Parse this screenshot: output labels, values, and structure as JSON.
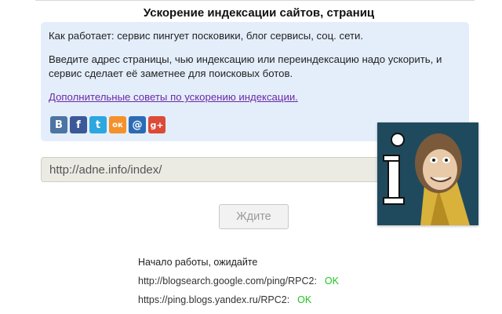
{
  "page": {
    "title": "Ускорение индексации сайтов, страниц"
  },
  "info": {
    "line1": "Как работает: сервис пингует посковики, блог сервисы, соц. сети.",
    "line2": "Введите адрес страницы, чью индексацию или переиндексацию надо ускорить, и сервис сделает её заметнее для поисковых ботов.",
    "link": "Дополнительные советы по ускорению индексации."
  },
  "social": [
    {
      "name": "vk",
      "glyph": "В",
      "color": "#4c75a3"
    },
    {
      "name": "facebook",
      "glyph": "f",
      "color": "#3b5998"
    },
    {
      "name": "twitter",
      "glyph": "t",
      "color": "#2ca7e0"
    },
    {
      "name": "odnoklassniki",
      "glyph": "ок",
      "color": "#f4912b"
    },
    {
      "name": "mail",
      "glyph": "@",
      "color": "#2b6bb5"
    },
    {
      "name": "googleplus",
      "glyph": "g+",
      "color": "#dc4a38"
    }
  ],
  "form": {
    "url_value": "http://adne.info/index/",
    "button_label": "Ждите"
  },
  "log": {
    "status": "Начало работы, ожидайте",
    "entries": [
      {
        "url": "http://blogsearch.google.com/ping/RPC2:",
        "result": "OK"
      },
      {
        "url": "https://ping.blogs.yandex.ru/RPC2:",
        "result": "OK"
      }
    ]
  }
}
